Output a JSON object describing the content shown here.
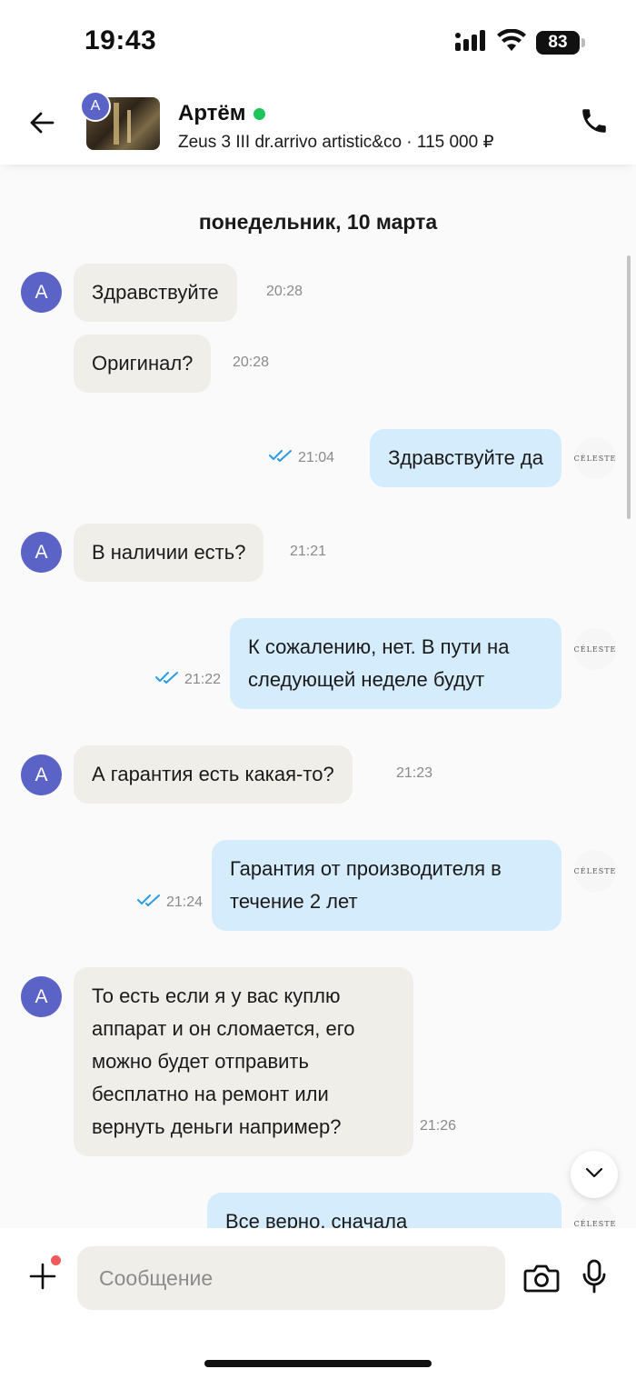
{
  "status_bar": {
    "time": "19:43",
    "battery": "83"
  },
  "header": {
    "avatar_letter": "А",
    "name": "Артём",
    "subtitle": "Zeus 3 III dr.arrivo artistic&co · 115 000 ₽"
  },
  "chat": {
    "date": "понедельник, 10 марта",
    "shop_avatar_text": "CÉLESTE",
    "messages": [
      {
        "direction": "in",
        "text": "Здравствуйте",
        "time": "20:28"
      },
      {
        "direction": "in",
        "text": "Оригинал?",
        "time": "20:28"
      },
      {
        "direction": "out",
        "text": "Здравствуйте да",
        "time": "21:04"
      },
      {
        "direction": "in",
        "text": "В наличии есть?",
        "time": "21:21"
      },
      {
        "direction": "out",
        "text": "К сожалению, нет. В пути на следующей неделе будут",
        "time": "21:22"
      },
      {
        "direction": "in",
        "text": "А гарантия есть какая-то?",
        "time": "21:23"
      },
      {
        "direction": "out",
        "text": "Гарантия от производителя в течение 2 лет",
        "time": "21:24"
      },
      {
        "direction": "in",
        "text": "То есть если я у вас куплю аппарат и он сломается, его можно будет отправить бесплатно на ремонт или вернуть деньги например?",
        "time": "21:26"
      },
      {
        "direction": "out",
        "text": "Все верно, сначала",
        "time": ""
      }
    ]
  },
  "composer": {
    "placeholder": "Сообщение"
  },
  "icons": {
    "back": "back-arrow-icon",
    "call": "phone-icon",
    "signal": "cellular-signal-icon",
    "wifi": "wifi-icon",
    "read": "double-check-icon",
    "scroll": "chevron-down-icon",
    "plus": "plus-icon",
    "camera": "camera-icon",
    "mic": "microphone-icon"
  },
  "colors": {
    "accent_avatar": "#5b63c7",
    "online": "#1dc45a",
    "out_bubble": "#d5ecfc",
    "in_bubble": "#f0eee9",
    "read_check": "#2b9be6",
    "notify_dot": "#f05a5a"
  }
}
